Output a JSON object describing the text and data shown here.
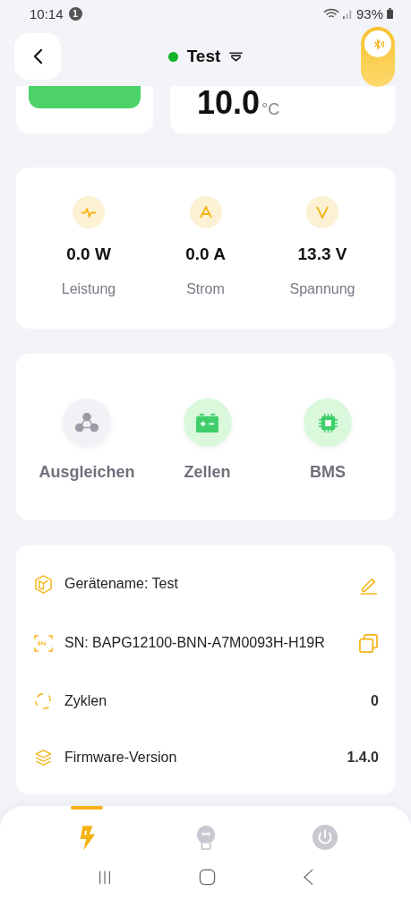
{
  "status_bar": {
    "time": "10:14",
    "notification_count": "1",
    "battery": "93%"
  },
  "header": {
    "title": "Test",
    "connected": true,
    "bluetooth_toggle": {
      "on": true
    }
  },
  "temperature": {
    "value": "10.0",
    "unit": "°C"
  },
  "metrics": [
    {
      "kind": "power",
      "value": "0.0 W",
      "label": "Leistung"
    },
    {
      "kind": "current",
      "value": "0.0 A",
      "label": "Strom"
    },
    {
      "kind": "voltage",
      "value": "13.3 V",
      "label": "Spannung"
    }
  ],
  "functions": [
    {
      "kind": "balance",
      "label": "Ausgleichen",
      "active": false
    },
    {
      "kind": "cells",
      "label": "Zellen",
      "active": true
    },
    {
      "kind": "bms",
      "label": "BMS",
      "active": true
    }
  ],
  "info": [
    {
      "kind": "name",
      "label": "Gerätename: Test",
      "editable": true
    },
    {
      "kind": "serial",
      "label": "SN: BAPG12100-BNN-A7M0093H-H19R",
      "copyable": true
    },
    {
      "kind": "cycles",
      "label": "Zyklen",
      "value": "0"
    },
    {
      "kind": "firmware",
      "label": "Firmware-Version",
      "value": "1.4.0"
    }
  ],
  "bottom_tabs": [
    {
      "kind": "power",
      "selected": true
    },
    {
      "kind": "light",
      "selected": false
    },
    {
      "kind": "switch",
      "selected": false
    }
  ]
}
